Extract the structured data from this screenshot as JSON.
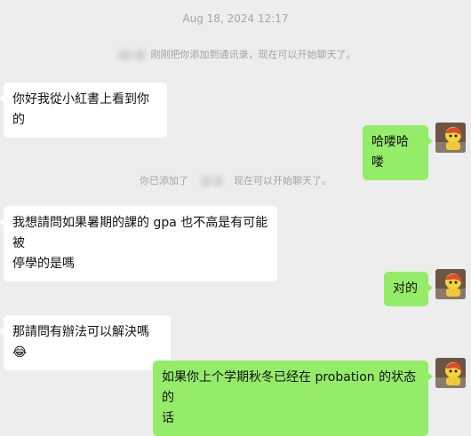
{
  "header": {
    "timestamp": "Aug 18, 2024 12:17"
  },
  "system_notices": {
    "added_to_contacts": "刚刚把你添加到通讯录，现在可以开始聊天了。",
    "you_added_prefix": "你已添加了",
    "you_added_suffix": "现在可以开始聊天了。"
  },
  "messages": [
    {
      "from": "other",
      "text": "你好我從小紅書上看到你的"
    },
    {
      "from": "me",
      "text": "哈喽哈喽"
    },
    {
      "from": "other",
      "line1": "我想請問如果暑期的課的 gpa 也不高是有可能被",
      "line2": "停學的是嗎"
    },
    {
      "from": "me",
      "text": "对的"
    },
    {
      "from": "other",
      "text": "那請問有辦法可以解決嗎",
      "emoji": "😂"
    },
    {
      "from": "me",
      "line1": "如果你上个学期秋冬已经在 probation 的状态的",
      "line2": "话"
    }
  ],
  "colors": {
    "background": "#ededed",
    "incoming_bubble": "#ffffff",
    "outgoing_bubble": "#95ec69",
    "system_text": "#a3a3a3"
  },
  "icons": {
    "self_avatar": "cartoon-avatar-icon",
    "redaction": "blurred-name"
  }
}
